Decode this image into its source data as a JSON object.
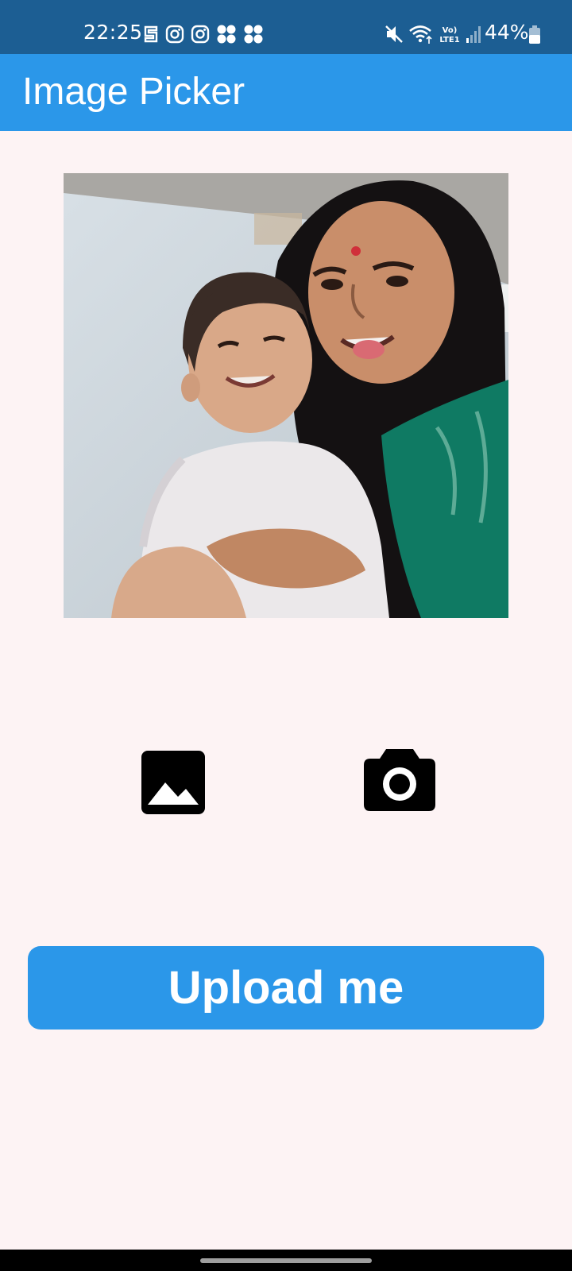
{
  "status_bar": {
    "time": "22:25",
    "battery": "44%",
    "left_icons": [
      "s-app-icon",
      "instagram-icon",
      "instagram-icon",
      "pinwheel-icon",
      "pinwheel-icon"
    ],
    "right_icons": [
      "mute-icon",
      "wifi-icon",
      "volte-icon",
      "signal-icon",
      "battery-icon"
    ]
  },
  "app_bar": {
    "title": "Image Picker",
    "color": "#2b97e9"
  },
  "photo": {
    "icon": "selected-photo"
  },
  "actions": {
    "gallery_icon": "image-gallery-icon",
    "camera_icon": "camera-icon"
  },
  "upload": {
    "label": "Upload me",
    "color": "#2b97e9"
  },
  "colors": {
    "background": "#fdf3f4",
    "status_bar": "#1c5e93",
    "accent": "#2b97e9"
  }
}
